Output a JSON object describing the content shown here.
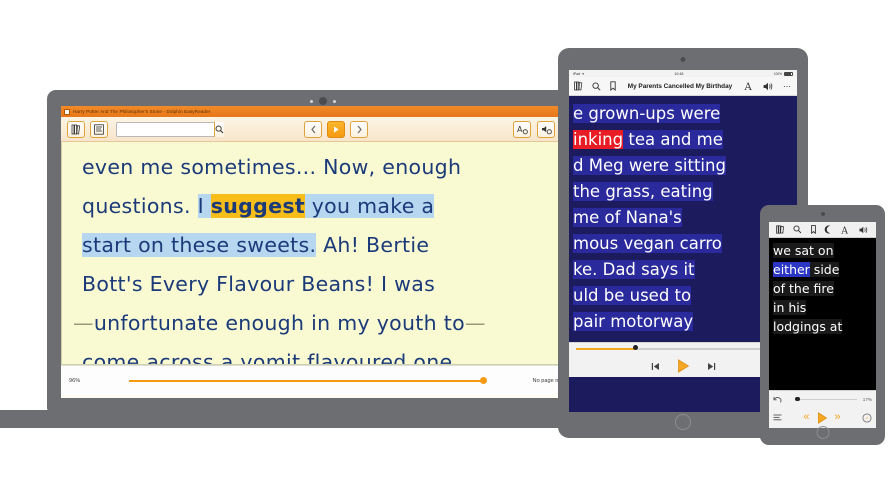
{
  "laptop": {
    "window_title": "Harry Potter And The Philosopher's Stone - Dolphin EasyReader",
    "window_buttons": {
      "minimize": "–",
      "maximize": "□",
      "close": "×"
    },
    "toolbar": {
      "library_icon": "book-library-icon",
      "contents_icon": "table-of-contents-icon",
      "search_placeholder": "",
      "search_value": "",
      "search_icon": "magnifier-icon",
      "previous_label": "‹",
      "play_label": "▶",
      "next_label": "›",
      "text_settings_icon": "font-settings-icon",
      "voice_settings_icon": "voice-settings-icon",
      "help_label": "?"
    },
    "reader": {
      "lines": [
        {
          "before": "even me sometimes... Now, enough",
          "highlight": "",
          "word": "",
          "after": ""
        },
        {
          "before": "questions. ",
          "pre_hl": "I ",
          "word": "suggest",
          "post_hl": " you make a",
          "after": ""
        },
        {
          "pre_hl": "start on these sweets.",
          "after": " Ah! Bertie"
        },
        {
          "before": "Bott's Every Flavour Beans! I was"
        },
        {
          "before": "unfortunate enough in my youth to",
          "dash_left": "—",
          "dash_right": "—"
        },
        {
          "before": "come across a vomit flavoured one,"
        }
      ]
    },
    "status": {
      "percent": "96%",
      "page_numbers": "No page numbers",
      "progress_value": 96
    }
  },
  "tablet": {
    "status_bar": {
      "device": "iPad",
      "wifi_icon": "wifi-icon",
      "time": "10:48",
      "battery": "100%"
    },
    "nav": {
      "library_icon": "book-library-icon",
      "search_icon": "magnifier-icon",
      "bookmark_icon": "bookmark-icon",
      "title": "My Parents Cancelled My Birthday",
      "font_icon": "font-size-icon",
      "speaker_icon": "speaker-icon",
      "more_icon": "more-options-icon"
    },
    "reader": {
      "lines": [
        "e grown-ups were",
        "inking tea and me",
        "d Meg were sitting",
        " the grass, eating",
        "me of Nana's",
        "mous vegan carro",
        "ke. Dad says it",
        "uld be used to",
        "pair motorway"
      ],
      "highlight_word": "inking",
      "highlight_color": "#e81c24"
    },
    "controls": {
      "rewind_icon": "skip-back-icon",
      "play_icon": "play-icon",
      "forward_icon": "skip-forward-icon",
      "progress_value": 28
    }
  },
  "phone": {
    "nav": {
      "library_icon": "book-library-icon",
      "search_icon": "magnifier-icon",
      "bookmark_icon": "bookmark-icon",
      "night_icon": "moon-night-mode-icon",
      "font_icon": "font-size-icon",
      "speaker_icon": "speaker-icon"
    },
    "reader": {
      "lines": [
        "we sat on",
        "either side",
        "of the fire",
        "in his",
        "lodgings at"
      ],
      "highlight_word": "either",
      "highlight_color": "#2b37c4"
    },
    "controls": {
      "back_icon": "undo-arrow-icon",
      "contents_icon": "table-of-contents-icon",
      "percent": "17%",
      "rewind_icon": "rewind-icon",
      "play_icon": "play-icon",
      "forward_icon": "fast-forward-icon",
      "speed_icon": "speed-dial-icon",
      "progress_value": 17
    }
  },
  "colors": {
    "accent_orange": "#f5a623",
    "title_orange": "#e8771a",
    "reader_page": "#fafad2",
    "reader_text": "#1b3a7a",
    "sentence_highlight": "#b6d7ef",
    "word_highlight": "#f7bd18",
    "tablet_bg": "#1b1b5e",
    "phone_bg": "#000000",
    "device_body": "#6d6e71"
  }
}
